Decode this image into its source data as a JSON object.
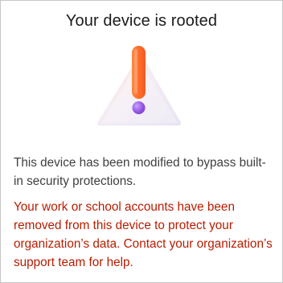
{
  "dialog": {
    "title": "Your device is rooted",
    "description": "This device has been modified to bypass built-in security protections.",
    "alert_message": "Your work or school accounts have been removed from this device to protect your organization’s data. Contact your organization’s support team for help.",
    "icon": "warning-exclamation-icon"
  },
  "colors": {
    "title_text": "#1b1b1b",
    "body_text": "#3f3f3f",
    "alert_text": "#b81c00",
    "exclamation_bar": "#ff6a2b",
    "exclamation_dot": "#9b5de8"
  }
}
